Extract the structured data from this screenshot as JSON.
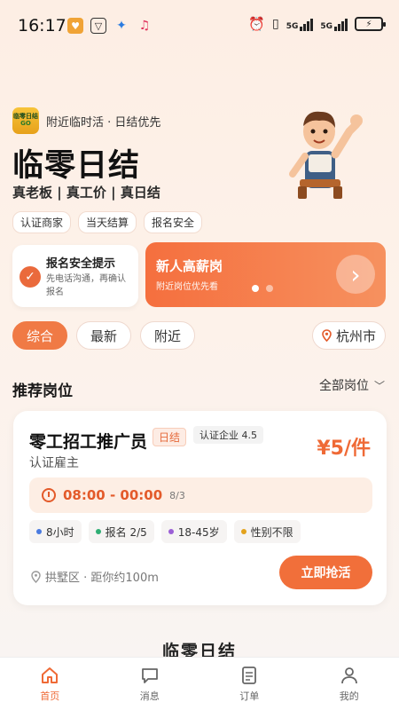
{
  "status_bar": {
    "time": "16:17",
    "network": "5G",
    "network2": "5G"
  },
  "header": {
    "brand_tagline": "附近临时活 · 日结优先",
    "logo_text_top": "临零日结",
    "logo_text_bottom": "GO",
    "title": "临零日结",
    "subtitle": "真老板 | 真工价 | 真日结",
    "tags": [
      "认证商家",
      "当天结算",
      "报名安全"
    ]
  },
  "safety_card": {
    "title": "报名安全提示",
    "desc": "先电话沟通，再确认报名"
  },
  "promo_card": {
    "title": "新人高薪岗",
    "subtitle": "附近岗位优先看",
    "slide_count": 2,
    "active_slide": 1
  },
  "filters": {
    "tabs": [
      {
        "label": "综合",
        "active": true
      },
      {
        "label": "最新",
        "active": false
      },
      {
        "label": "附近",
        "active": false
      }
    ],
    "city": "杭州市"
  },
  "section": {
    "title": "推荐岗位",
    "all_jobs": "全部岗位"
  },
  "job": {
    "title": "零工招工推广员",
    "badge_day": "日结",
    "badge_cert": "认证企业 4.5",
    "employer": "认证雇主",
    "price": "¥5/件",
    "time": "08:00 - 00:00",
    "date": "8/3",
    "chips": [
      {
        "label": "8小时",
        "color": "#4a7be0"
      },
      {
        "label": "报名 2/5",
        "color": "#2fae74"
      },
      {
        "label": "18-45岁",
        "color": "#9b5fd6"
      },
      {
        "label": "性别不限",
        "color": "#e3a21c"
      }
    ],
    "location": "拱墅区 · 距你约100m",
    "action": "立即抢活"
  },
  "footer_title": "临零日结",
  "tabbar": [
    {
      "label": "首页",
      "icon": "home-icon",
      "active": true
    },
    {
      "label": "消息",
      "icon": "message-icon",
      "active": false
    },
    {
      "label": "订单",
      "icon": "order-icon",
      "active": false
    },
    {
      "label": "我的",
      "icon": "profile-icon",
      "active": false
    }
  ],
  "colors": {
    "accent": "#f07a45",
    "price": "#ef6a36"
  }
}
